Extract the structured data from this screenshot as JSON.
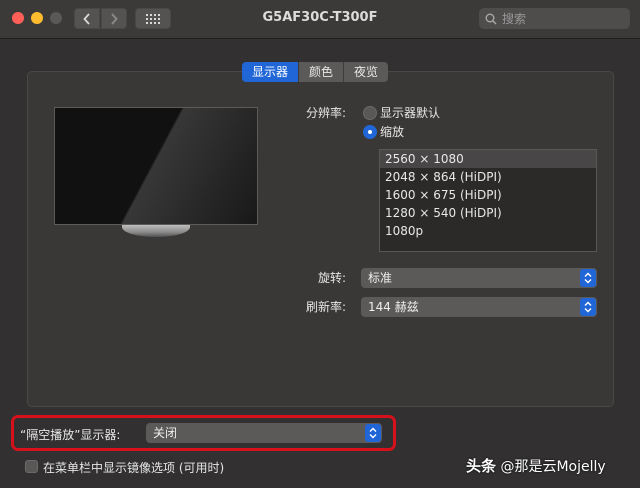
{
  "window": {
    "title": "G5AF30C-T300F"
  },
  "toolbar": {
    "back_icon": "chevron-left-icon",
    "forward_icon": "chevron-right-icon",
    "grid_icon": "grid-icon",
    "search_placeholder": "搜索"
  },
  "tabs": [
    {
      "label": "显示器",
      "active": true
    },
    {
      "label": "颜色",
      "active": false
    },
    {
      "label": "夜览",
      "active": false
    }
  ],
  "resolution": {
    "label": "分辨率:",
    "options": [
      {
        "label": "显示器默认",
        "selected": false
      },
      {
        "label": "缩放",
        "selected": true
      }
    ],
    "list": [
      {
        "label": "2560 × 1080",
        "selected": true
      },
      {
        "label": "2048 × 864 (HiDPI)",
        "selected": false
      },
      {
        "label": "1600 × 675 (HiDPI)",
        "selected": false
      },
      {
        "label": "1280 × 540 (HiDPI)",
        "selected": false
      },
      {
        "label": "1080p",
        "selected": false
      }
    ]
  },
  "rotation": {
    "label": "旋转:",
    "value": "标准"
  },
  "refresh": {
    "label": "刷新率:",
    "value": "144 赫兹"
  },
  "airplay": {
    "label": "“隔空播放”显示器:",
    "value": "关闭"
  },
  "mirror_option": {
    "label": "在菜单栏中显示镜像选项 (可用时)",
    "checked": false
  },
  "watermark": {
    "brand": "头条",
    "handle": "@那是云Mojelly"
  },
  "colors": {
    "accent": "#2166d6",
    "highlight": "#d6111b"
  }
}
